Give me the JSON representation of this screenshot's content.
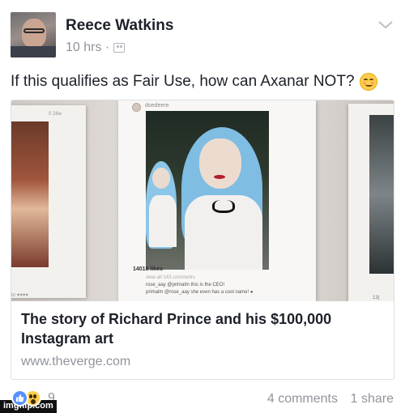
{
  "post": {
    "author": "Reece Watkins",
    "time": "10 hrs ·",
    "privacy_icon": "friends-icon",
    "text": "If this qualifies as Fair Use, how can Axanar NOT?",
    "text_emoji": "smiling-face-icon"
  },
  "link": {
    "title": "The story of Richard Prince and his $100,000 Instagram art",
    "domain": "www.theverge.com",
    "image": {
      "left_print_likes": "0 28w",
      "left_print_bottom": "bt ♥♥♥♥",
      "main_handle": "doedeere",
      "main_likes": "14018 likes",
      "main_view_comments": "view all 143 comments",
      "main_caption_1": "rose_aay @primalm this is the CEO!",
      "main_caption_2": "primalm @rose_aay she even has a cool name! ●",
      "right_print_bottom": "13("
    }
  },
  "footer": {
    "reaction_count": "9",
    "comments": "4 comments",
    "shares": "1 share"
  },
  "watermark": "imgflip.com",
  "colors": {
    "text": "#1d2129",
    "muted": "#90949c",
    "like_blue": "#5890ff",
    "border": "#dddfe2"
  }
}
